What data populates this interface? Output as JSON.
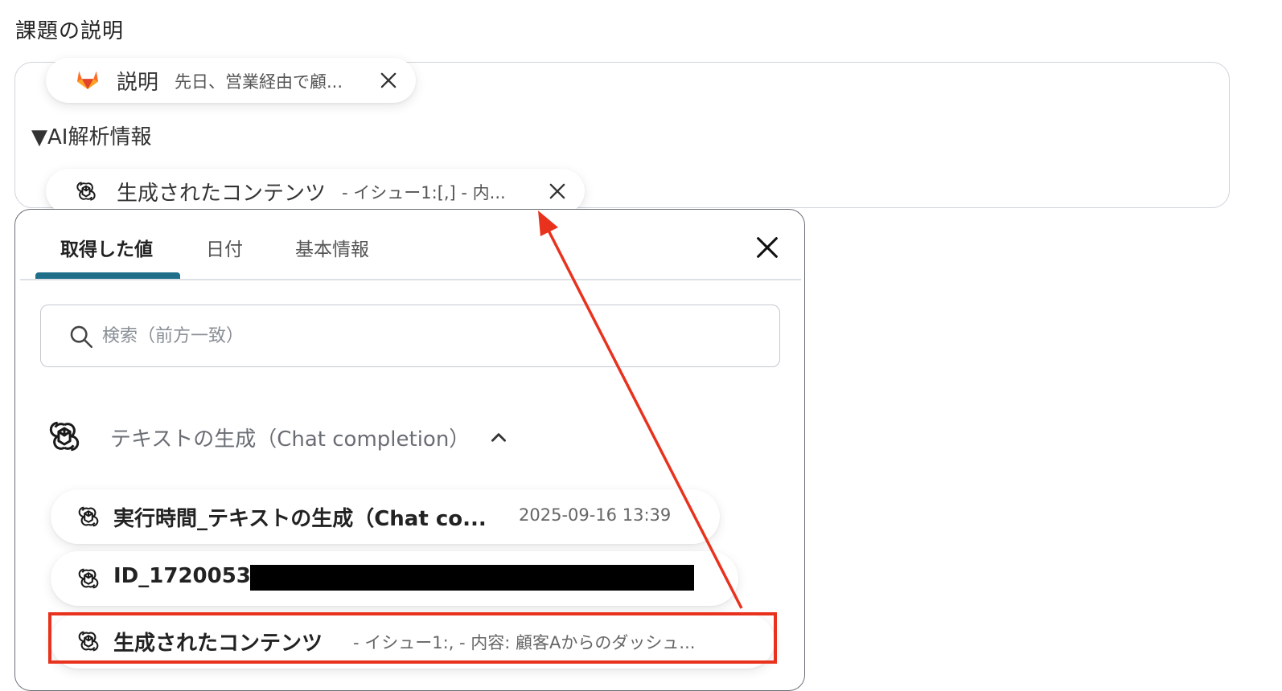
{
  "field": {
    "label": "課題の説明"
  },
  "description_field": {
    "pill_description": {
      "name": "説明",
      "value": "先日、営業経由で顧..."
    },
    "section_heading": "▼AI解析情報",
    "pill_generated": {
      "name": "生成されたコンテンツ",
      "value": "- イシュー1:[,] - 内..."
    }
  },
  "panel": {
    "tabs": [
      {
        "label": "取得した値",
        "active": true
      },
      {
        "label": "日付",
        "active": false
      },
      {
        "label": "基本情報",
        "active": false
      }
    ],
    "search": {
      "placeholder": "検索（前方一致）",
      "value": ""
    },
    "group": {
      "title": "テキストの生成（Chat completion）",
      "expanded": true
    },
    "items": [
      {
        "name": "実行時間_テキストの生成（Chat co...",
        "value": "2025-09-16 13:39"
      },
      {
        "name": "ID_1720053",
        "value": ""
      },
      {
        "name": "生成されたコンテンツ",
        "value": "- イシュー1:, - 内容: 顧客Aからのダッシュ..."
      }
    ]
  },
  "colors": {
    "accent": "#1f6f8b",
    "annotation": "#e8321e",
    "gitlab_orange": "#fc6d26",
    "gitlab_red": "#e24329",
    "gitlab_light": "#fca326"
  },
  "icons": {
    "gitlab": "gitlab-icon",
    "openai": "openai-icon",
    "close": "close-icon",
    "search": "search-icon",
    "chevron": "chevron-up-icon"
  }
}
